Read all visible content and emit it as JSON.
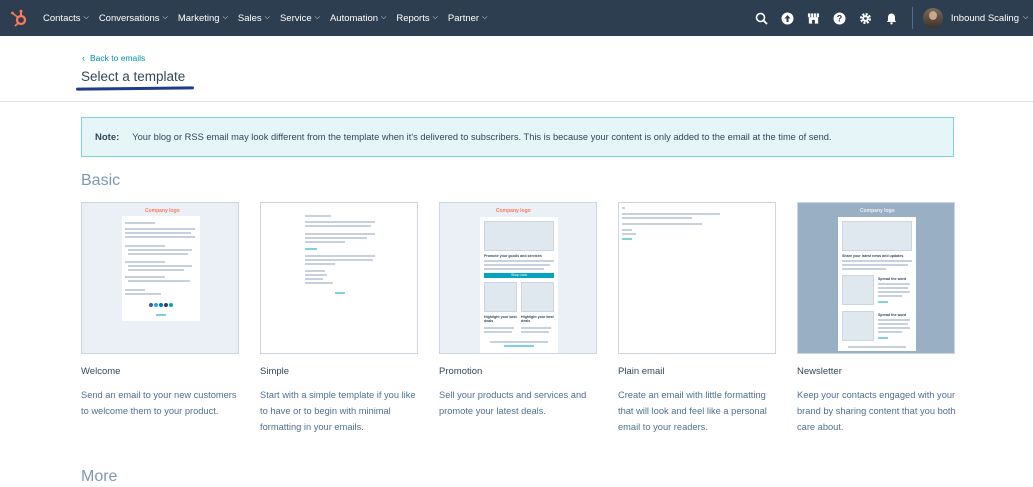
{
  "nav": {
    "items": [
      "Contacts",
      "Conversations",
      "Marketing",
      "Sales",
      "Service",
      "Automation",
      "Reports",
      "Partner"
    ],
    "account_name": "Inbound Scaling",
    "colors": {
      "bar": "#2d3e50",
      "logo": "#ff7a59"
    }
  },
  "page": {
    "back_label": "Back to emails",
    "title": "Select a template",
    "note_label": "Note:",
    "note_text": "Your blog or RSS email may look different from the template when it's delivered to subscribers. This is because your content is only added to the email at the time of send.",
    "section_basic": "Basic",
    "section_more": "More"
  },
  "templates": [
    {
      "name": "Welcome",
      "description": "Send an email to your new customers to welcome them to your product.",
      "thumb_logo": "Company logo"
    },
    {
      "name": "Simple",
      "description": "Start with a simple template if you like to have or to begin with minimal formatting in your emails.",
      "thumb_logo": ""
    },
    {
      "name": "Promotion",
      "description": "Sell your products and services and promote your latest deals.",
      "thumb_logo": "Company logo"
    },
    {
      "name": "Plain email",
      "description": "Create an email with little formatting that will look and feel like a personal email to your readers.",
      "thumb_logo": ""
    },
    {
      "name": "Newsletter",
      "description": "Keep your contacts engaged with your brand by sharing content that you both care about.",
      "thumb_logo": "Company logo"
    }
  ],
  "thumb_text": {
    "promo_heading": "Promote your goods and services",
    "promo_button": "Shop now",
    "promo_item_1": "Highlight your best deals",
    "promo_item_2": "Highlight your best deals",
    "news_heading": "Share your latest news and updates",
    "news_item_1": "Spread the word",
    "news_item_2": "Spread the word"
  }
}
